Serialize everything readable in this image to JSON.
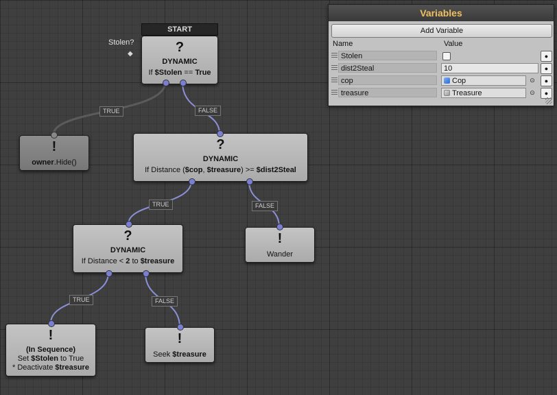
{
  "start_header": "START",
  "stolen_tag": "Stolen?",
  "nodes": {
    "root": {
      "glyph": "?",
      "title": "DYNAMIC",
      "cond_pre": "If ",
      "cond_var": "$Stolen",
      "cond_op": " == ",
      "cond_val": "True"
    },
    "hide": {
      "glyph": "!",
      "obj": "owner",
      "method": ".Hide()"
    },
    "dist": {
      "glyph": "?",
      "title": "DYNAMIC",
      "cond_pre": "If Distance (",
      "cond_a": "$cop",
      "cond_sep": ", ",
      "cond_b": "$treasure",
      "cond_post": ")  >=  ",
      "cond_c": "$dist2Steal"
    },
    "near": {
      "glyph": "?",
      "title": "DYNAMIC",
      "cond_pre": "If Distance < ",
      "cond_num": "2",
      "cond_mid": " to ",
      "cond_var": "$treasure"
    },
    "wander": {
      "glyph": "!",
      "label": "Wander"
    },
    "seq": {
      "glyph": "!",
      "title": "(In Sequence)",
      "l1_pre": "Set ",
      "l1_var": "$Stolen",
      "l1_post": " to True",
      "l2_pre": "* Deactivate ",
      "l2_var": "$treasure"
    },
    "seek": {
      "glyph": "!",
      "pre": "Seek ",
      "var": "$treasure"
    }
  },
  "wire_labels": {
    "root_true": "TRUE",
    "root_false": "FALSE",
    "dist_true": "TRUE",
    "dist_false": "FALSE",
    "near_true": "TRUE",
    "near_false": "FALSE"
  },
  "variables_panel": {
    "title": "Variables",
    "add_button": "Add Variable",
    "col_name": "Name",
    "col_value": "Value",
    "rows": [
      {
        "name": "Stolen",
        "type": "bool",
        "value": false
      },
      {
        "name": "dist2Steal",
        "type": "float",
        "value": "10"
      },
      {
        "name": "cop",
        "type": "object",
        "value": "Cop",
        "icon": "blue-cube-icon"
      },
      {
        "name": "treasure",
        "type": "object",
        "value": "Treasure",
        "icon": "grey-cube-icon"
      }
    ],
    "row_menu_glyph": "●",
    "picker_glyph": "⊙"
  },
  "colors": {
    "wire_active": "#8c90d8",
    "wire_inactive": "#5e5e5e",
    "panel_title": "#f0c060"
  }
}
